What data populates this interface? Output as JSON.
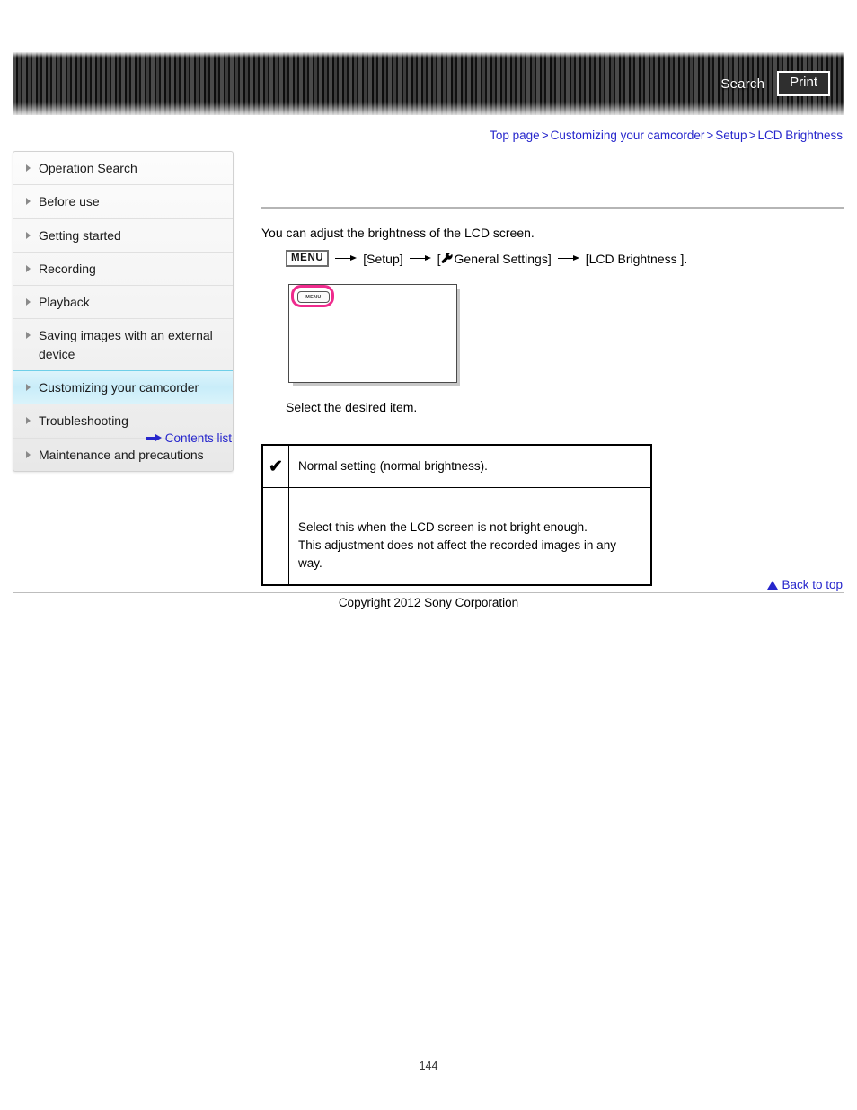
{
  "header": {
    "search_label": "Search",
    "print_label": "Print"
  },
  "breadcrumb": {
    "items": [
      {
        "label": "Top page"
      },
      {
        "label": "Customizing your camcorder"
      },
      {
        "label": "Setup"
      },
      {
        "label": "LCD Brightness"
      }
    ],
    "separator": ">"
  },
  "sidebar": {
    "items": [
      {
        "label": "Operation Search",
        "selected": false
      },
      {
        "label": "Before use",
        "selected": false
      },
      {
        "label": "Getting started",
        "selected": false
      },
      {
        "label": "Recording",
        "selected": false
      },
      {
        "label": "Playback",
        "selected": false
      },
      {
        "label": "Saving images with an external device",
        "selected": false
      },
      {
        "label": "Customizing your camcorder",
        "selected": true
      },
      {
        "label": "Troubleshooting",
        "selected": false
      },
      {
        "label": "Maintenance and precautions",
        "selected": false
      }
    ],
    "contents_list_label": "Contents list"
  },
  "main": {
    "intro": "You can adjust the brightness of the LCD screen.",
    "menu_path": {
      "menu_chip": "MENU",
      "step1": "[Setup]",
      "step2": "General Settings]",
      "step2_prefix": "[",
      "step3": "[LCD Brightness ]."
    },
    "lcd_figure": {
      "menu_button_label": "MENU",
      "highlight_color": "#ef2b8d"
    },
    "select_item": "Select the desired item.",
    "table": {
      "rows": [
        {
          "mark": "✔",
          "text": "Normal setting (normal brightness)."
        },
        {
          "mark": "",
          "text": "Select this when the LCD screen is not bright enough.\nThis adjustment does not affect the recorded images in any way."
        }
      ]
    }
  },
  "footer": {
    "back_to_top_label": "Back to top",
    "copyright": "Copyright 2012 Sony Corporation",
    "page_number": "144"
  }
}
